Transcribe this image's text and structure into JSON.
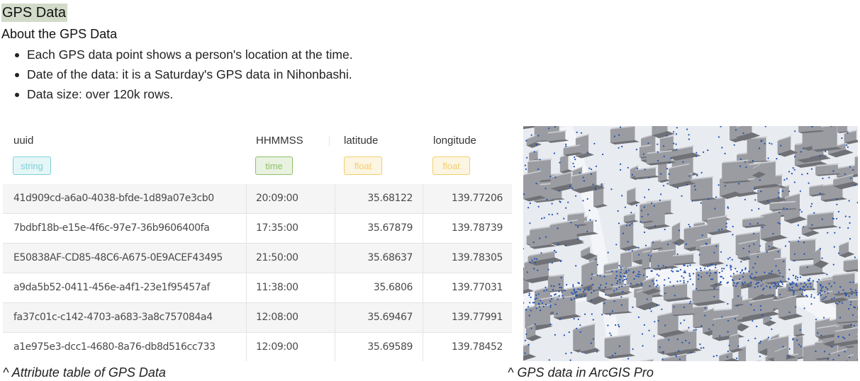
{
  "page_title": "GPS Data",
  "section_heading": "About the GPS Data",
  "bullets": [
    "Each GPS data point shows a person's location at the time.",
    "Date of the data: it is a Saturday's GPS data in Nihonbashi.",
    "Data size: over 120k rows."
  ],
  "table": {
    "columns": [
      {
        "name": "uuid",
        "type": "string",
        "type_color": "#7fd0d8"
      },
      {
        "name": "HHMMSS",
        "type": "time",
        "type_color": "#8fbf6a"
      },
      {
        "name": "latitude",
        "type": "float",
        "type_color": "#f0cf6e"
      },
      {
        "name": "longitude",
        "type": "float",
        "type_color": "#f0cf6e"
      }
    ],
    "rows": [
      [
        "41d909cd-a6a0-4038-bfde-1d89a07e3cb0",
        "20:09:00",
        "35.68122",
        "139.77206"
      ],
      [
        "7bdbf18b-e15e-4f6c-97e7-36b9606400fa",
        "17:35:00",
        "35.67879",
        "139.78739"
      ],
      [
        "E50838AF-CD85-48C6-A675-0E9ACEF43495",
        "21:50:00",
        "35.68637",
        "139.78305"
      ],
      [
        "a9da5b52-0411-456e-a4f1-23e1f95457af",
        "11:38:00",
        "35.6806",
        "139.77031"
      ],
      [
        "fa37c01c-c142-4703-a683-3a8c757084a4",
        "12:08:00",
        "35.69467",
        "139.77991"
      ],
      [
        "a1e975e3-dcc1-4680-8a76-db8d516cc733",
        "12:09:00",
        "35.69589",
        "139.78452"
      ]
    ]
  },
  "captions": {
    "table": "^ Attribute table of GPS Data",
    "map": "^ GPS data in ArcGIS Pro"
  },
  "map": {
    "building_color": "#9a9ca1",
    "ground_color": "#e8ebf0",
    "gps_point_color": "#1f4fb4"
  }
}
